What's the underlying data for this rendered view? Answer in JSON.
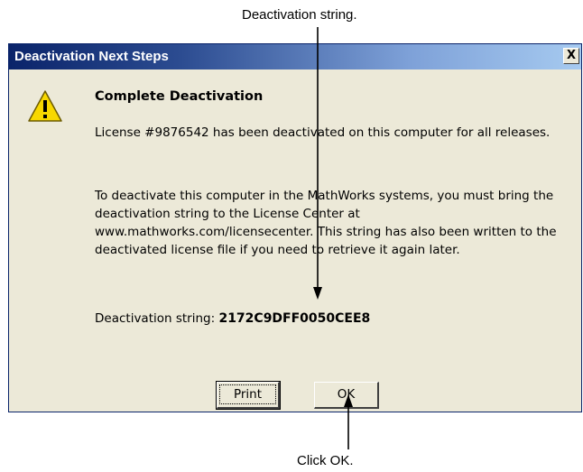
{
  "annotations": {
    "top": "Deactivation string.",
    "bottom": "Click OK."
  },
  "dialog": {
    "title": "Deactivation Next Steps",
    "close_label": "X",
    "heading": "Complete Deactivation",
    "para1": "License #9876542 has been deactivated on this computer for all releases.",
    "para2": "To deactivate this computer in the MathWorks systems, you must bring the deactivation string to the License Center at www.mathworks.com/licensecenter. This string has also been written to the deactivated license file if you need to retrieve it again later.",
    "deactivation_label": "Deactivation string:",
    "deactivation_value": "2172C9DFF0050CEE8",
    "buttons": {
      "print": "Print",
      "ok": "OK"
    },
    "icon": "warning-icon",
    "colors": {
      "titlebar_start": "#0a246a",
      "titlebar_end": "#a6caf0",
      "background": "#ece9d8",
      "warning": "#f8d800"
    }
  }
}
